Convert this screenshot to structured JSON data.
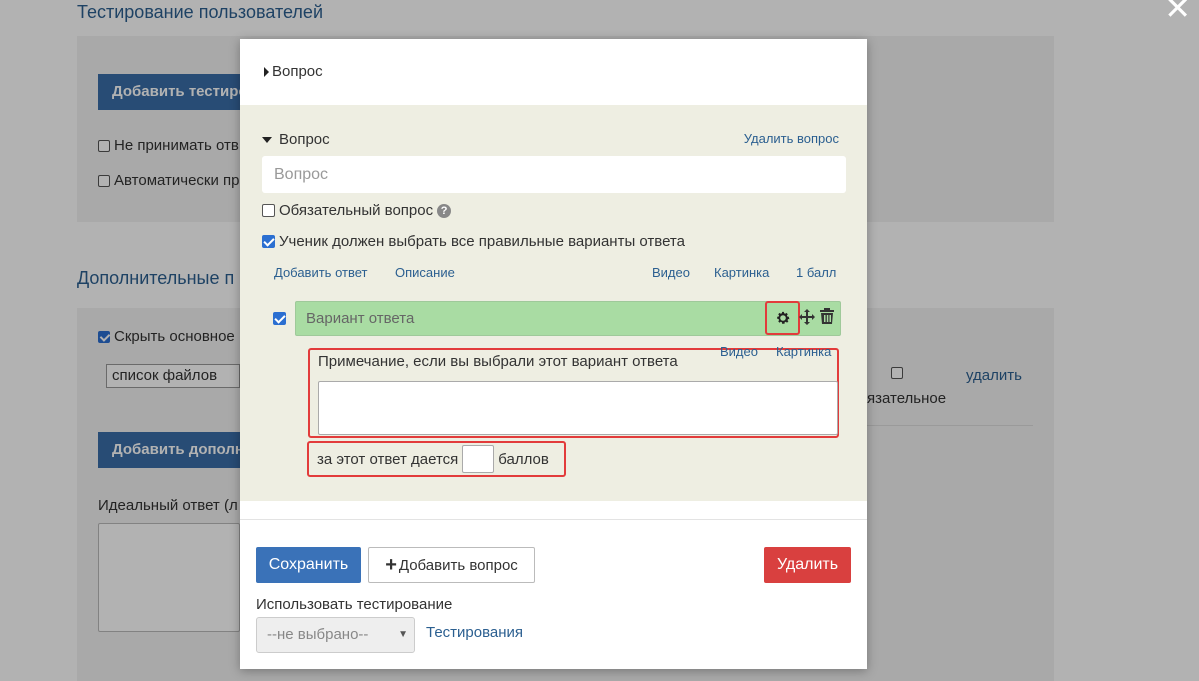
{
  "background": {
    "title": "Тестирование пользователей",
    "add_test_button": "Добавить тестиро",
    "option_no_accept": "Не принимать отв",
    "option_auto": "Автоматически пр",
    "section_title": "Дополнительные п",
    "hide_main": "Скрыть основное",
    "files_select": "список файлов",
    "required_fragment": "язательное",
    "delete_link": "удалить",
    "add_extra_button": "Добавить дополн",
    "ideal_answer": "Идеальный ответ (л"
  },
  "modal": {
    "header_label": "Вопрос",
    "question": {
      "section_label": "Вопрос",
      "delete_label": "Удалить вопрос",
      "input_placeholder": "Вопрос",
      "required_label": "Обязательный вопрос",
      "required_checked": false,
      "all_correct_label": "Ученик должен выбрать все правильные варианты ответа",
      "all_correct_checked": true,
      "links": {
        "add_answer": "Добавить ответ",
        "description": "Описание",
        "video": "Видео",
        "image": "Картинка",
        "points": "1 балл"
      }
    },
    "answer": {
      "checked": true,
      "placeholder": "Вариант ответа",
      "note_label": "Примечание, если вы выбрали этот вариант ответа",
      "note_video": "Видео",
      "note_image": "Картинка",
      "score_prefix": "за этот ответ дается",
      "score_value": "",
      "score_suffix": "баллов"
    },
    "footer": {
      "save": "Сохранить",
      "add_question": "Добавить вопрос",
      "delete": "Удалить",
      "use_testing_label": "Использовать тестирование",
      "select_value": "--не выбрано--",
      "testing_link": "Тестирования"
    }
  },
  "colors": {
    "accent": "#3a72b8",
    "danger": "#d9403f",
    "answer_bg": "#a9dca3",
    "panel_bg": "#eeeee2",
    "highlight": "#e23b3b"
  }
}
